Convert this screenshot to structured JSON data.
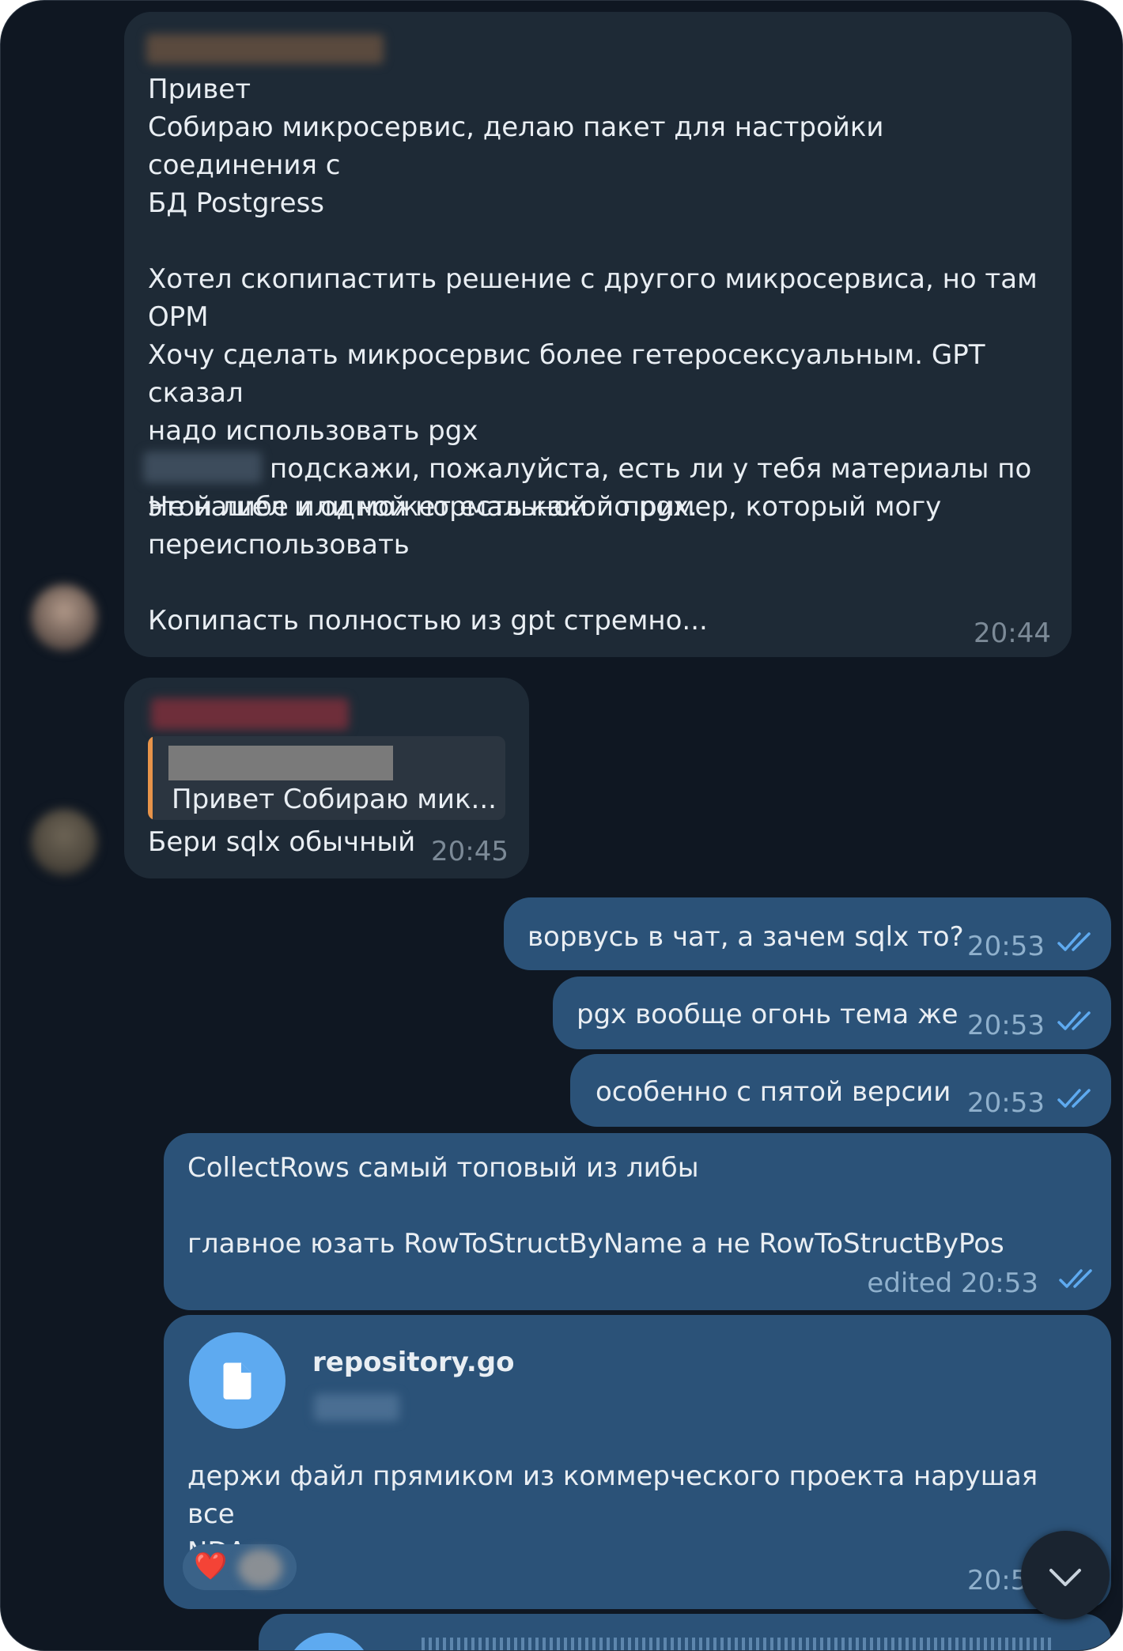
{
  "messages": {
    "m1": {
      "text": "Привет\nСобираю микросервис, делаю пакет для настройки соединения с\nБД Postgress\n\nХотел скопипастить решение с другого микросервиса, но там\nОРМ\nХочу сделать микросервис более гетеросексуальным. GPT сказал\nнадо использовать pgx\n\nНе нашел и одной нормальной по pgx.",
      "mention_rest": "подскажи, пожалуйста, есть ли у тебя материалы по",
      "text_end": "этой либе или может есть какой пример, который могу\nпереиспользовать\n\nКопипасть полностью из gpt стремно...",
      "time": "20:44"
    },
    "m2": {
      "reply_preview": "Привет Собираю мик...",
      "text": "Бери sqlx обычный",
      "time": "20:45"
    },
    "m3": {
      "text": "ворвусь в чат, а зачем sqlx то?",
      "time": "20:53"
    },
    "m4": {
      "text": "pgx вообще огонь тема же",
      "time": "20:53"
    },
    "m5": {
      "text": "особенно с пятой версии",
      "time": "20:53"
    },
    "m6": {
      "text": "CollectRows самый топовый из либы\n\nглавное юзать RowToStructByName а не RowToStructByPos",
      "time": "edited 20:53"
    },
    "m7": {
      "file_name": "repository.go",
      "text": "держи файл прямиком из коммерческого проекта нарушая все\nNDA",
      "reaction": "❤️",
      "time": "20:5"
    }
  },
  "icons": {
    "file": "file-icon",
    "read": "double-check-icon",
    "scroll": "chevron-down-icon",
    "reaction": "heart-icon"
  },
  "colors": {
    "background": "#0f1722",
    "incoming": "#1e2a36",
    "outgoing": "#2b5278",
    "accent": "#5eaaf0",
    "reply_bar": "#e8944a"
  }
}
